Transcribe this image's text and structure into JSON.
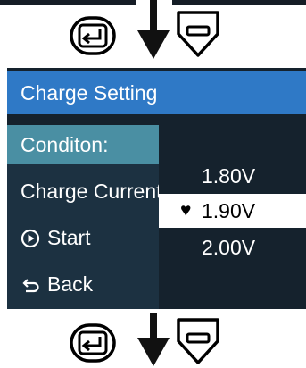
{
  "screen": {
    "title": "Charge Setting",
    "menu_items": [
      {
        "label": "Conditon:",
        "selected": true,
        "icon": ""
      },
      {
        "label": "Charge Current:",
        "selected": false,
        "icon": ""
      },
      {
        "label": "Start",
        "selected": false,
        "icon": "play-circle-icon"
      },
      {
        "label": "Back",
        "selected": false,
        "icon": "back-arrow-icon"
      }
    ],
    "values": [
      {
        "label": "1.80V",
        "selected": false
      },
      {
        "label": "1.90V",
        "selected": true,
        "marker": "♥"
      },
      {
        "label": "2.00V",
        "selected": false
      }
    ]
  },
  "flow": {
    "enter_icon": "enter-key-icon",
    "down_arrow_icon": "down-arrow-icon",
    "minus_icon": "minus-key-icon"
  },
  "colors": {
    "title_bar": "#2f79c6",
    "screen_bg": "#15222d",
    "menu_bg": "#1c3141",
    "menu_selected": "#4a8fa3",
    "value_selected_bg": "#ffffff"
  }
}
